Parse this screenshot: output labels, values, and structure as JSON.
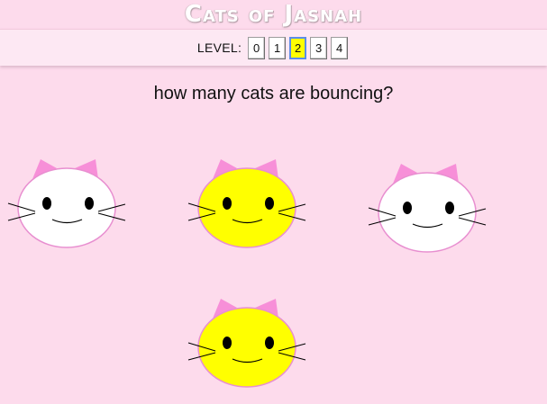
{
  "app": {
    "title": "Cats of Jasnah"
  },
  "levels": {
    "label": "LEVEL:",
    "options": [
      "0",
      "1",
      "2",
      "3",
      "4"
    ],
    "selected": "2",
    "selected_color": "#ffff00"
  },
  "question": {
    "text": "how many cats are bouncing?"
  },
  "cats": [
    {
      "color": "white",
      "fill": "#ffffff"
    },
    {
      "color": "yellow",
      "fill": "#ffff00"
    },
    {
      "color": "white",
      "fill": "#ffffff"
    },
    {
      "color": "yellow",
      "fill": "#ffff00"
    }
  ],
  "colors": {
    "background": "#fddbec",
    "ears": "#f78fd8",
    "outline": "#e88fd0"
  }
}
